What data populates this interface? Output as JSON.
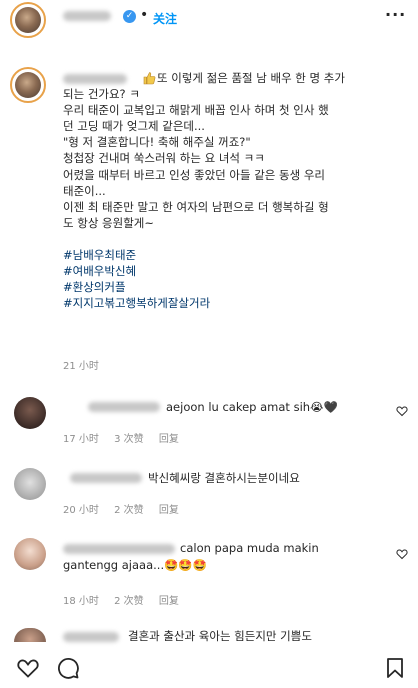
{
  "post": {
    "follow_label": "关注",
    "more_label": "···",
    "caption_lines": [
      "또 이렇게 젊은 품절 남 배우 한 명 추가",
      "되는 건가요? ㅋ",
      "우리 태준이 교복입고 해맑게 배꼽 인사 하며 첫 인사 했",
      "던 고딩 때가 엊그제 같은데...",
      "\"형 저 결혼합니다! 축해 해주실 꺼죠?\"",
      "청첩장 건내며 쑥스러워 하는 요 녀석 ㅋㅋ",
      "어렸을 때부터 바르고 인성 좋았던 아들 같은 동생 우리",
      "태준이...",
      "이젠 최 태준만 말고 한 여자의 남편으로 더 행복하길 형",
      "도 항상 응원할게~"
    ],
    "hashtags": [
      "#남배우최태준",
      "#여배우박신혜",
      "#환상의커플",
      "#지지고볶고행복하게잘살거라"
    ],
    "time": "21 小时"
  },
  "comments": [
    {
      "text": "aejoon lu cakep amat sih😭🖤",
      "time": "17 小时",
      "likes": "3 次赞",
      "reply": "回复"
    },
    {
      "text": "박신혜씨랑 결혼하시는분이네요",
      "time": "20 小时",
      "likes": "2 次赞",
      "reply": "回复"
    },
    {
      "text_line1": "calon papa muda makin",
      "text_line2": "gantengg ajaaa...🤩🤩🤩",
      "time": "18 小时",
      "likes": "2 次赞",
      "reply": "回复"
    },
    {
      "text": "결혼과 출산과 육아는 힘든지만 기쁨도"
    }
  ],
  "colors": {
    "hashtag": "#00376b",
    "follow": "#0095f6",
    "meta": "#8e8e8e",
    "verified": "#3897f0"
  },
  "icons": [
    "verified-badge-icon",
    "more-options-icon",
    "like-icon",
    "heart-outline-icon",
    "comment-icon",
    "share-icon",
    "save-icon"
  ]
}
